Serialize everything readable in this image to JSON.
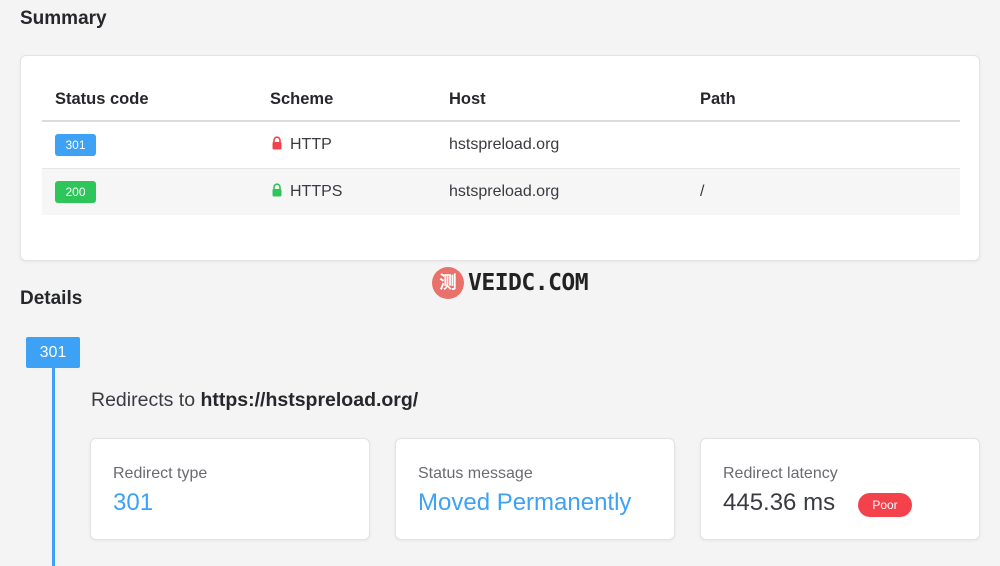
{
  "summary": {
    "title": "Summary",
    "columns": [
      "Status code",
      "Scheme",
      "Host",
      "Path"
    ],
    "rows": [
      {
        "status": "301",
        "status_color": "#3da1f5",
        "scheme": "HTTP",
        "lock_icon": "lock-open-icon",
        "lock_color": "#f4424c",
        "host": "hstspreload.org",
        "path": ""
      },
      {
        "status": "200",
        "status_color": "#2ec55a",
        "scheme": "HTTPS",
        "lock_icon": "lock-closed-icon",
        "lock_color": "#2ec55a",
        "host": "hstspreload.org",
        "path": "/"
      }
    ]
  },
  "watermark": {
    "glyph": "测",
    "text": "VEIDC.COM"
  },
  "details": {
    "title": "Details",
    "timeline_badge": "301",
    "redirect_prefix": "Redirects to ",
    "redirect_url": "https://hstspreload.org/",
    "cards": {
      "redirect_type": {
        "label": "Redirect type",
        "value": "301"
      },
      "status_message": {
        "label": "Status message",
        "value": "Moved Permanently"
      },
      "redirect_latency": {
        "label": "Redirect latency",
        "value": "445.36 ms",
        "rating": "Poor"
      }
    }
  },
  "colors": {
    "accent": "#3da1f5",
    "success": "#2ec55a",
    "danger": "#f4424c"
  }
}
